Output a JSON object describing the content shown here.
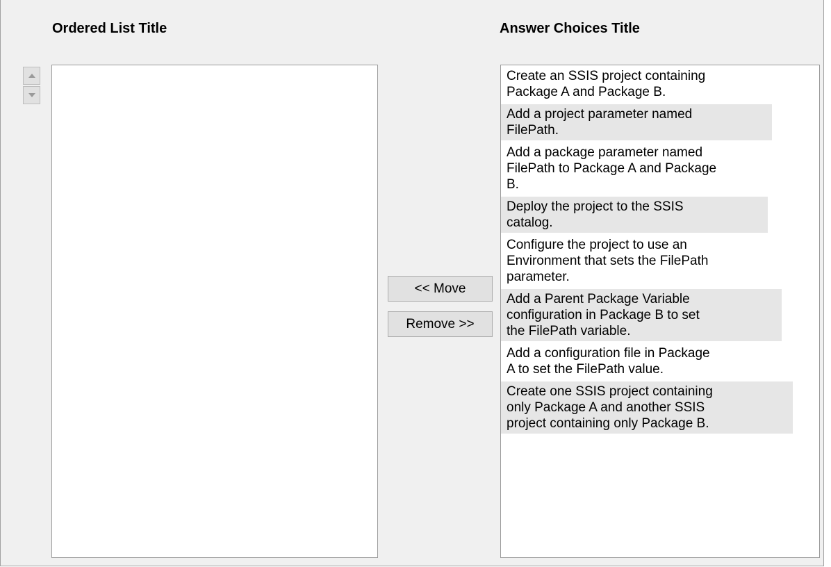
{
  "ordered_list": {
    "title": "Ordered List Title",
    "items": []
  },
  "answer_choices": {
    "title": "Answer Choices Title",
    "items": [
      {
        "lines": [
          "Create an SSIS project containing",
          "Package A and Package B."
        ],
        "shaded": false
      },
      {
        "lines": [
          "Add a project parameter named",
          "FilePath."
        ],
        "shaded": true
      },
      {
        "lines": [
          "Add a package parameter named",
          "FilePath to Package A and Package",
          "B."
        ],
        "shaded": false
      },
      {
        "lines": [
          "Deploy the project to the SSIS",
          "catalog."
        ],
        "shaded": true
      },
      {
        "lines": [
          "Configure the project to use an",
          "Environment that sets the FilePath",
          "parameter."
        ],
        "shaded": false
      },
      {
        "lines": [
          "Add a Parent Package Variable",
          "configuration in Package B to set",
          "the FilePath variable."
        ],
        "shaded": true
      },
      {
        "lines": [
          "Add a configuration file in Package",
          "A to set the FilePath value."
        ],
        "shaded": false
      },
      {
        "lines": [
          "Create one SSIS project containing",
          "only Package A and another SSIS",
          "project containing only Package B."
        ],
        "shaded": true
      }
    ]
  },
  "buttons": {
    "move_label": "<< Move",
    "remove_label": "Remove >>"
  },
  "icons": {
    "up": "up-arrow-icon",
    "down": "down-arrow-icon"
  }
}
